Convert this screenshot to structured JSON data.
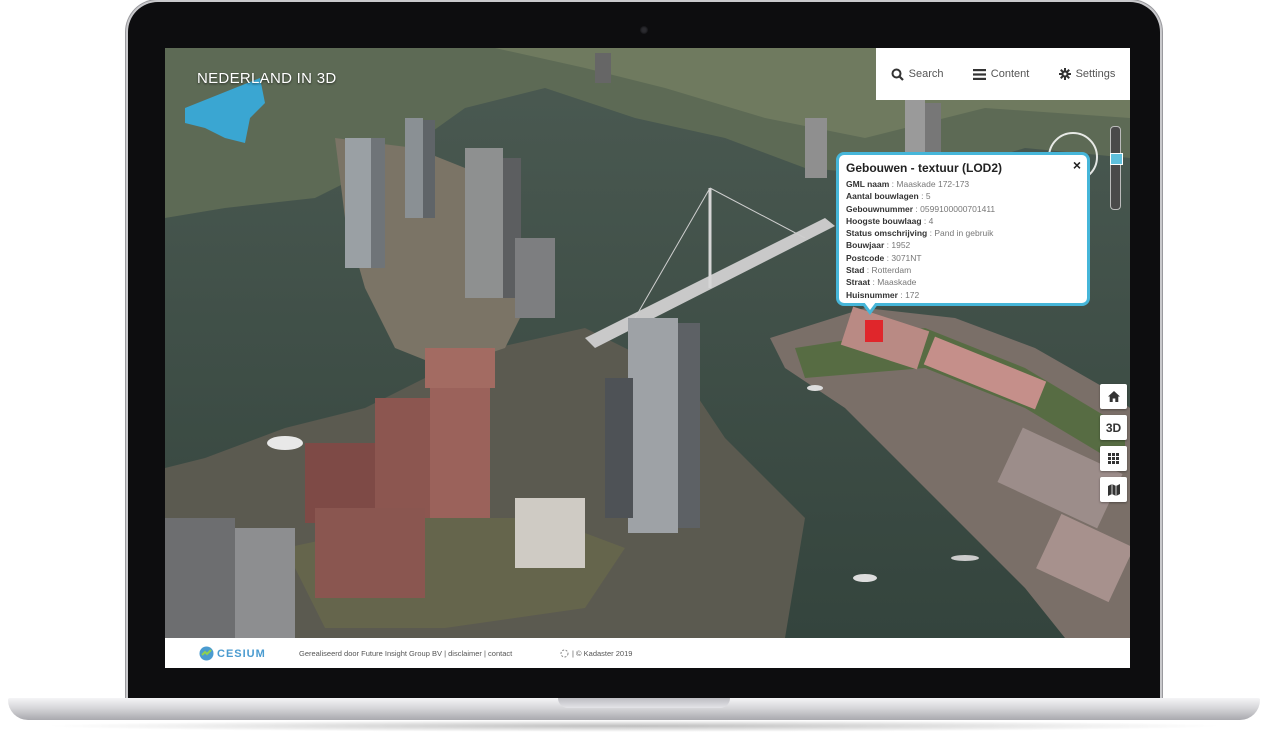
{
  "app": {
    "title": "NEDERLAND IN 3D"
  },
  "menu": [
    {
      "label": "Search",
      "icon": "search-icon"
    },
    {
      "label": "Content",
      "icon": "menu-icon"
    },
    {
      "label": "Settings",
      "icon": "gear-icon"
    }
  ],
  "popup": {
    "title": "Gebouwen - textuur (LOD2)",
    "close": "×",
    "attributes": [
      {
        "key": "GML naam",
        "value": "Maaskade 172-173"
      },
      {
        "key": "Aantal bouwlagen",
        "value": "5"
      },
      {
        "key": "Gebouwnummer",
        "value": "0599100000701411"
      },
      {
        "key": "Hoogste bouwlaag",
        "value": "4"
      },
      {
        "key": "Status omschrijving",
        "value": "Pand in gebruik"
      },
      {
        "key": "Bouwjaar",
        "value": "1952"
      },
      {
        "key": "Postcode",
        "value": "3071NT"
      },
      {
        "key": "Stad",
        "value": "Rotterdam"
      },
      {
        "key": "Straat",
        "value": "Maaskade"
      },
      {
        "key": "Huisnummer",
        "value": "172"
      }
    ]
  },
  "tools": {
    "home": "home-icon",
    "mode3d": "3D",
    "grid": "grid-icon",
    "map": "map-icon"
  },
  "footer": {
    "cesium": "CESIUM",
    "credit_prefix": "Gerealiseerd door Future Insight Group BV",
    "disclaimer": "disclaimer",
    "contact": "contact",
    "separator": "|",
    "kadaster": "| © Kadaster 2019"
  },
  "colors": {
    "accent": "#46b6d9",
    "water": "#3f5048",
    "highlight": "#e0262b"
  }
}
